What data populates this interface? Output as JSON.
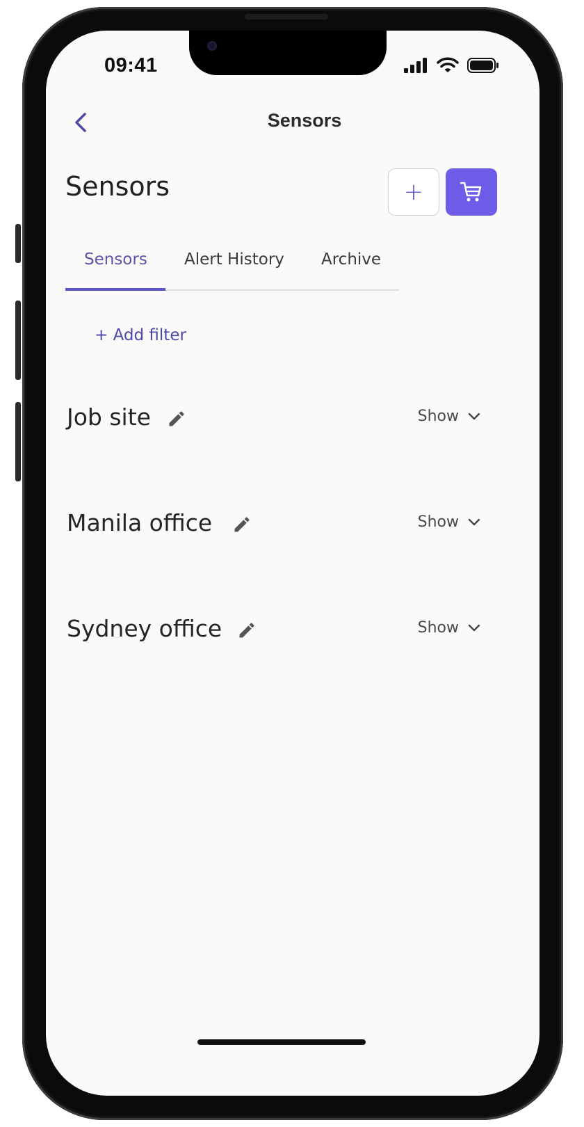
{
  "status_bar": {
    "time": "09:41",
    "icons": [
      "cellular-signal-icon",
      "wifi-icon",
      "battery-icon"
    ]
  },
  "nav": {
    "back_icon": "chevron-left-icon",
    "title": "Sensors"
  },
  "header": {
    "title": "Sensors",
    "add_icon_glyph": "+",
    "cart_icon": "shopping-cart-icon"
  },
  "tabs": [
    {
      "label": "Sensors",
      "active": true
    },
    {
      "label": "Alert History",
      "active": false
    },
    {
      "label": "Archive",
      "active": false
    }
  ],
  "filter": {
    "add_label": "+ Add filter"
  },
  "groups": [
    {
      "name": "Job site",
      "toggle_label": "Show"
    },
    {
      "name": "Manila office",
      "toggle_label": "Show"
    },
    {
      "name": "Sydney office",
      "toggle_label": "Show"
    }
  ],
  "colors": {
    "accent": "#6c5ce7",
    "accent_text": "#5b54c8",
    "screen_background": "#fbfaf8",
    "text_primary": "#252525"
  }
}
